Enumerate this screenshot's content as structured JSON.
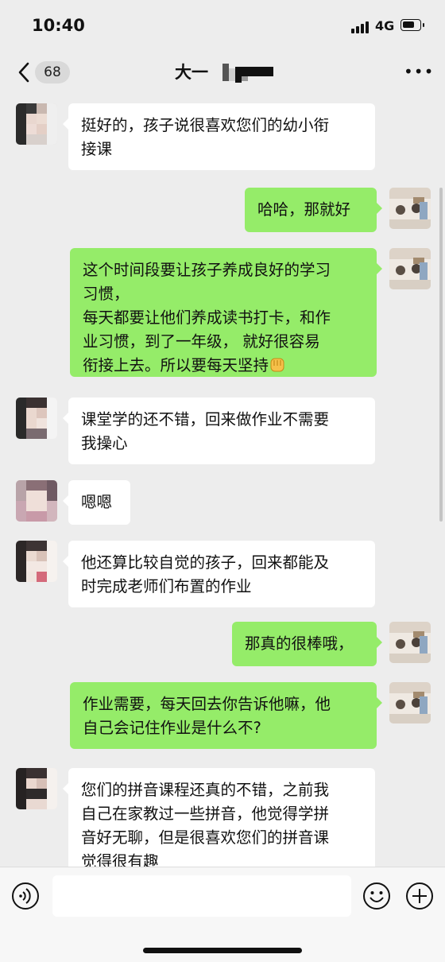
{
  "status_bar": {
    "time": "10:40",
    "network": "4G"
  },
  "header": {
    "unread_count": "68",
    "title": "大一"
  },
  "messages": [
    {
      "side": "in",
      "text": "挺好的，孩子说很喜欢您们的幼小衔\n接课"
    },
    {
      "side": "out",
      "text": "哈哈，那就好"
    },
    {
      "side": "out",
      "text": "这个时间段要让孩子养成良好的学习\n习惯，\n每天都要让他们养成读书打卡，和作\n业习惯，到了一年级， 就好很容易\n衔接上去。所以要每天坚持"
    },
    {
      "side": "in",
      "text": "课堂学的还不错，回来做作业不需要\n我操心"
    },
    {
      "side": "in",
      "text": "嗯嗯"
    },
    {
      "side": "in",
      "text": "他还算比较自觉的孩子，回来都能及\n时完成老师们布置的作业"
    },
    {
      "side": "out",
      "text": "那真的很棒哦，"
    },
    {
      "side": "out",
      "text": "作业需要，每天回去你告诉他嘛，他\n自己会记住作业是什么不?"
    },
    {
      "side": "in",
      "text": "您们的拼音课程还真的不错，之前我\n自己在家教过一些拼音，他觉得学拼\n音好无聊，但是很喜欢您们的拼音课\n觉得很有趣"
    }
  ],
  "icons": {
    "back": "chevron-left-icon",
    "more": "more-icon",
    "voice": "voice-icon",
    "emoji": "emoji-icon",
    "plus": "plus-icon",
    "fist": "fist-emoji-icon"
  },
  "colors": {
    "background": "#ededed",
    "incoming_bubble": "#ffffff",
    "outgoing_bubble": "#95ec69"
  },
  "input": {
    "value": ""
  }
}
